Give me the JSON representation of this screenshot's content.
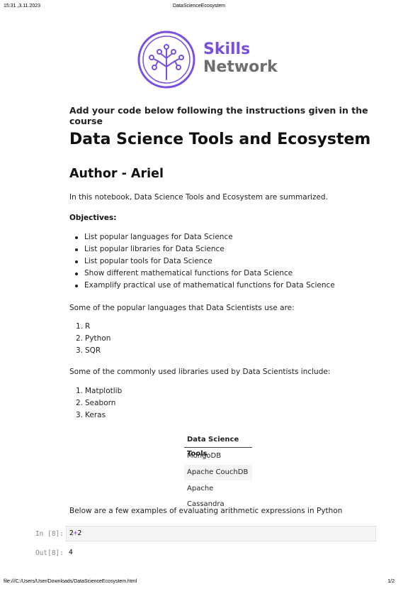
{
  "browser_header": {
    "datetime": "15:31 ,3.11.2023",
    "title": "DataScienceEcosystem"
  },
  "logo": {
    "line1": "Skills",
    "line2": "Network",
    "icon": "tree-network-icon",
    "colors": {
      "primary": "#7a4fdd",
      "secondary": "#6e6e6e"
    }
  },
  "instructions": "Add your code below following the instructions given in the course",
  "title": "Data Science Tools and Ecosystem",
  "author": "Author - Ariel",
  "intro": "In this notebook, Data Science Tools and Ecosystem are summarized.",
  "objectives_label": "Objectives:",
  "objectives": [
    "List popular languages for Data Science",
    "List popular libraries for Data Science",
    "List popular tools for Data Science",
    "Show different mathematical functions for Data Science",
    "Examplify practical use of mathematical functions for Data Science"
  ],
  "languages_intro": "Some of the popular languages that Data Scientists use are:",
  "languages": [
    "R",
    "Python",
    "SQR"
  ],
  "libraries_intro": "Some of the commonly used libraries used by Data Scientists include:",
  "libraries": [
    "Matplotlib",
    "Seaborn",
    "Keras"
  ],
  "tools_table": {
    "header": "Data Science Tools",
    "rows": [
      "MongoDB",
      "Apache CouchDB",
      "Apache Cassandra"
    ]
  },
  "arith_intro": "Below are a few examples of evaluating arithmetic expressions in Python",
  "cell": {
    "in_prompt": "In [8]:",
    "code_left": "2",
    "code_op": "+",
    "code_right": "2",
    "out_prompt": "Out[8]:",
    "output": "4"
  },
  "browser_footer": {
    "path": "file:///C:/Users/User/Downloads/DataScienceEcosystem.html",
    "page": "1/2"
  }
}
